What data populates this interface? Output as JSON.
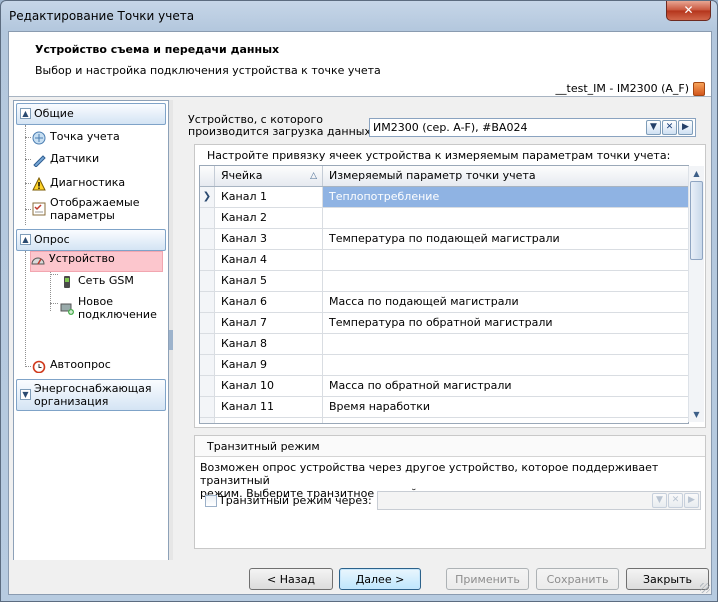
{
  "window": {
    "title": "Редактирование Точки учета",
    "close_glyph": "✕"
  },
  "header": {
    "title": "Устройство съема и передачи данных",
    "subtitle": "Выбор и настройка подключения устройства к точке учета",
    "device": "__test_IM - IM2300 (A_F)"
  },
  "nav": {
    "groups": [
      {
        "label": "Общие",
        "items": [
          {
            "label": "Точка учета",
            "icon": "meter-point-icon"
          },
          {
            "label": "Датчики",
            "icon": "sensor-icon"
          },
          {
            "label": "Диагностика",
            "icon": "warning-icon"
          },
          {
            "label1": "Отображаемые",
            "label2": "параметры",
            "icon": "checklist-icon"
          }
        ]
      },
      {
        "label": "Опрос",
        "items": [
          {
            "label": "Устройство",
            "icon": "gauge-icon",
            "selected": true
          },
          {
            "label": "Сеть GSM",
            "icon": "phone-icon"
          },
          {
            "label1": "Новое",
            "label2": "подключение",
            "icon": "new-connection-icon"
          },
          {
            "label": "Автоопрос",
            "icon": "alarm-clock-icon"
          }
        ]
      },
      {
        "label1": "Энергоснабжающая",
        "label2": "организация"
      }
    ]
  },
  "device_select": {
    "label1": "Устройство, с которого",
    "label2": "производится загрузка данных:",
    "value": "ИМ2300 (сер. A-F), #BA024"
  },
  "binding": {
    "title": "Настройте привязку ячеек устройства к измеряемым параметрам точки учета:",
    "columns": {
      "cell": "Ячейка",
      "param": "Измеряемый параметр точки учета"
    },
    "sort_glyph": "△",
    "rows": [
      {
        "cell": "Канал 1",
        "param": "Теплопотребление",
        "selected": true
      },
      {
        "cell": "Канал 2",
        "param": ""
      },
      {
        "cell": "Канал 3",
        "param": "Температура по подающей магистрали"
      },
      {
        "cell": "Канал 4",
        "param": ""
      },
      {
        "cell": "Канал 5",
        "param": ""
      },
      {
        "cell": "Канал 6",
        "param": "Масса по подающей магистрали"
      },
      {
        "cell": "Канал 7",
        "param": "Температура по обратной магистрали"
      },
      {
        "cell": "Канал 8",
        "param": ""
      },
      {
        "cell": "Канал 9",
        "param": ""
      },
      {
        "cell": "Канал 10",
        "param": "Масса по обратной магистрали"
      },
      {
        "cell": "Канал 11",
        "param": "Время наработки"
      },
      {
        "cell": "",
        "param": ""
      }
    ]
  },
  "transit": {
    "title": "Транзитный режим",
    "desc1": "Возможен опрос устройства через другое устройство, которое поддерживает транзитный",
    "desc2": "режим. Выберите транзитное устройство:",
    "checkbox_label": "Транзитный режим через:",
    "checked": false
  },
  "buttons": {
    "back": "< Назад",
    "next": "Далее >",
    "apply": "Применить",
    "save": "Сохранить",
    "close": "Закрыть"
  }
}
